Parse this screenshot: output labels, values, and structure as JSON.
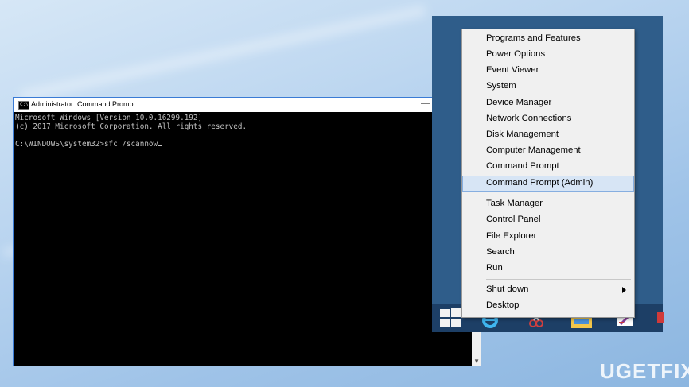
{
  "cmd_window": {
    "title": "Administrator: Command Prompt",
    "icon_text": "C:\\",
    "minimize_glyph": "—",
    "lines": [
      "Microsoft Windows [Version 10.0.16299.192]",
      "(c) 2017 Microsoft Corporation. All rights reserved.",
      "",
      "C:\\WINDOWS\\system32>sfc /scannow"
    ]
  },
  "winx_menu": {
    "group1": [
      "Programs and Features",
      "Power Options",
      "Event Viewer",
      "System",
      "Device Manager",
      "Network Connections",
      "Disk Management",
      "Computer Management",
      "Command Prompt",
      "Command Prompt (Admin)"
    ],
    "group2": [
      "Task Manager",
      "Control Panel",
      "File Explorer",
      "Search",
      "Run"
    ],
    "group3": [
      "Shut down",
      "Desktop"
    ],
    "highlighted": "Command Prompt (Admin)"
  },
  "taskbar": {
    "icons": [
      "start-windows-icon",
      "internet-explorer-icon",
      "snipping-tool-icon",
      "file-explorer-icon",
      "paint-icon"
    ]
  },
  "watermark": "UGETFIX"
}
